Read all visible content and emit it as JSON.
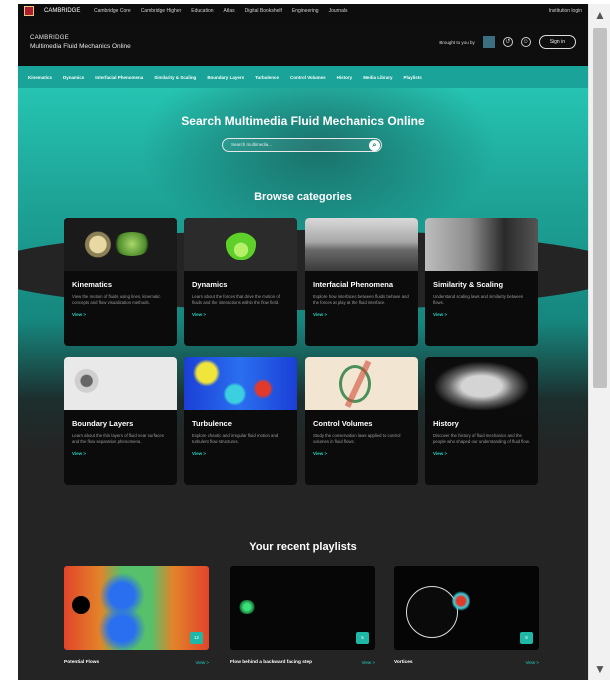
{
  "topbar": {
    "brand": "CAMBRIDGE",
    "links": [
      "Cambridge Core",
      "Cambridge Higher",
      "Education",
      "Atlas",
      "Digital Bookshelf",
      "Engineering",
      "Journals"
    ],
    "account": "Institution login"
  },
  "header": {
    "title_top": "CAMBRIDGE",
    "title_main": "Multimedia Fluid Mechanics Online",
    "brought_by": "Brought to you by",
    "signin": "Sign in"
  },
  "nav": [
    "Kinematics",
    "Dynamics",
    "Interfacial Phenomena",
    "Similarity & Scaling",
    "Boundary Layers",
    "Turbulence",
    "Control Volumes",
    "History",
    "Media Library",
    "Playlists"
  ],
  "search": {
    "title": "Search Multimedia Fluid Mechanics Online",
    "placeholder": "Search multimedia..."
  },
  "browse_title": "Browse categories",
  "categories": [
    {
      "title": "Kinematics",
      "desc": "View the motion of fluids using lines, kinematic concepts and flow visualization methods.",
      "view": "View >"
    },
    {
      "title": "Dynamics",
      "desc": "Learn about the forces that drive the motion of fluids and the interactions within the flow field.",
      "view": "View >"
    },
    {
      "title": "Interfacial Phenomena",
      "desc": "Explore how interfaces between fluids behave and the forces at play at the fluid interface.",
      "view": "View >"
    },
    {
      "title": "Similarity & Scaling",
      "desc": "Understand scaling laws and similarity between flows.",
      "view": "View >"
    },
    {
      "title": "Boundary Layers",
      "desc": "Learn about the thin layers of fluid near surfaces and the flow separation phenomena.",
      "view": "View >"
    },
    {
      "title": "Turbulence",
      "desc": "Explore chaotic and irregular fluid motion and turbulent flow structures.",
      "view": "View >"
    },
    {
      "title": "Control Volumes",
      "desc": "Study the conservation laws applied to control volumes in fluid flows.",
      "view": "View >"
    },
    {
      "title": "History",
      "desc": "Discover the history of fluid mechanics and the people who shaped our understanding of fluid flow.",
      "view": "View >"
    }
  ],
  "playlists_title": "Your recent playlists",
  "playlists": [
    {
      "name": "Potential Flows",
      "count": "12",
      "more": "View >"
    },
    {
      "name": "Flow behind a backward facing step",
      "count": "5",
      "more": "View >"
    },
    {
      "name": "Vortices",
      "count": "8",
      "more": "View >"
    }
  ],
  "colors": {
    "accent": "#1fb7a6",
    "nav": "#1aa398",
    "background": "#242424"
  }
}
